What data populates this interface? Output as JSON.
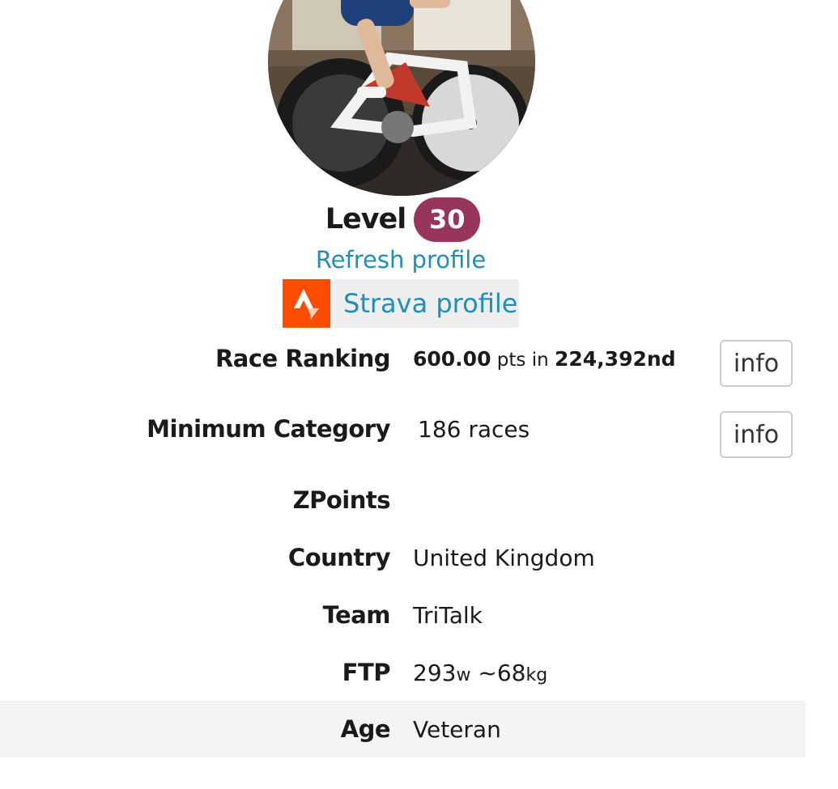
{
  "profile": {
    "level_label": "Level",
    "level_value": "30",
    "refresh_label": "Refresh profile",
    "strava_label": "Strava profile"
  },
  "stats": {
    "race_ranking": {
      "label": "Race Ranking",
      "points": "600.00",
      "pts_text": "pts in",
      "rank": "224,392nd",
      "info_label": "info"
    },
    "minimum_category": {
      "label": "Minimum Category",
      "value": "186 races",
      "info_label": "info"
    },
    "zpoints": {
      "label": "ZPoints",
      "value": ""
    },
    "country": {
      "label": "Country",
      "value": "United Kingdom"
    },
    "team": {
      "label": "Team",
      "value": "TriTalk"
    },
    "ftp": {
      "label": "FTP",
      "watts": "293",
      "watts_unit": "w",
      "weight": "~68",
      "weight_unit": "kg"
    },
    "age": {
      "label": "Age",
      "value": "Veteran"
    }
  },
  "colors": {
    "level_badge": "#97365a",
    "link": "#1d8fba",
    "strava_orange": "#fc4c02"
  },
  "icons": {
    "strava": "strava-logo-icon"
  }
}
